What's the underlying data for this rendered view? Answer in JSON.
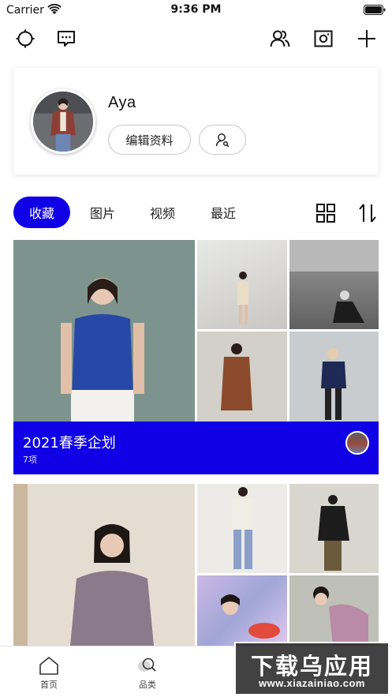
{
  "status_bar": {
    "carrier": "Carrier",
    "time": "9:36 PM"
  },
  "top_nav": {
    "icons": [
      "compass-icon",
      "message-icon",
      "people-icon",
      "camera-frame-icon",
      "plus-icon"
    ]
  },
  "profile": {
    "name": "Aya",
    "edit_label": "编辑资料"
  },
  "tabs": [
    {
      "label": "收藏",
      "active": true
    },
    {
      "label": "图片",
      "active": false
    },
    {
      "label": "视频",
      "active": false
    },
    {
      "label": "最近",
      "active": false
    }
  ],
  "albums": [
    {
      "title": "2021春季企划",
      "count": "7项"
    }
  ],
  "bottom_nav": [
    {
      "label": "首页"
    },
    {
      "label": "品类"
    }
  ],
  "watermark": {
    "title": "下载乌应用",
    "url": "www.xiazainiao.com"
  },
  "colors": {
    "accent": "#1000e6"
  }
}
